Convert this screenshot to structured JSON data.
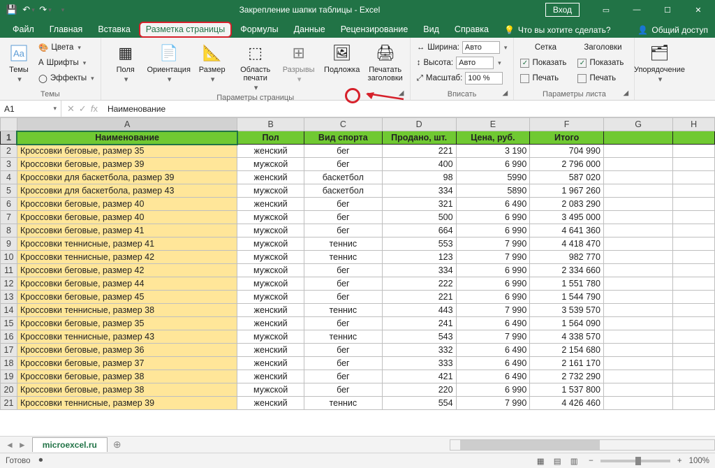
{
  "titlebar": {
    "title": "Закрепление шапки таблицы  -  Excel",
    "login": "Вход"
  },
  "tabs": {
    "file": "Файл",
    "home": "Главная",
    "insert": "Вставка",
    "pagelayout": "Разметка страницы",
    "formulas": "Формулы",
    "data": "Данные",
    "review": "Рецензирование",
    "view": "Вид",
    "help": "Справка",
    "tellme": "Что вы хотите сделать?",
    "share": "Общий доступ"
  },
  "ribbon": {
    "themes_group": "Темы",
    "themes_btn": "Темы",
    "colors": "Цвета",
    "fonts": "Шрифты",
    "effects": "Эффекты",
    "page_setup_group": "Параметры страницы",
    "margins": "Поля",
    "orientation": "Ориентация",
    "size": "Размер",
    "print_area": "Область печати",
    "breaks": "Разрывы",
    "background": "Подложка",
    "print_titles": "Печатать заголовки",
    "scale_group": "Вписать",
    "width_lbl": "Ширина:",
    "width_val": "Авто",
    "height_lbl": "Высота:",
    "height_val": "Авто",
    "scale_lbl": "Масштаб:",
    "scale_val": "100 %",
    "sheet_opts_group": "Параметры листа",
    "gridlines": "Сетка",
    "headings": "Заголовки",
    "show": "Показать",
    "print": "Печать",
    "arrange_group": "Упорядочение",
    "arrange_btn": "Упорядочение"
  },
  "namebox": "A1",
  "formula": "Наименование",
  "columns": [
    "A",
    "B",
    "C",
    "D",
    "E",
    "F",
    "G",
    "H"
  ],
  "headers": {
    "name": "Наименование",
    "gender": "Пол",
    "sport": "Вид спорта",
    "sold": "Продано, шт.",
    "price": "Цена, руб.",
    "total": "Итого"
  },
  "rows": [
    {
      "n": "Кроссовки беговые, размер 35",
      "g": "женский",
      "s": "бег",
      "sold": "221",
      "p": "3 190",
      "t": "704 990"
    },
    {
      "n": "Кроссовки беговые, размер 39",
      "g": "мужской",
      "s": "бег",
      "sold": "400",
      "p": "6 990",
      "t": "2 796 000"
    },
    {
      "n": "Кроссовки для баскетбола, размер 39",
      "g": "женский",
      "s": "баскетбол",
      "sold": "98",
      "p": "5990",
      "t": "587 020"
    },
    {
      "n": "Кроссовки для баскетбола, размер 43",
      "g": "мужской",
      "s": "баскетбол",
      "sold": "334",
      "p": "5890",
      "t": "1 967 260"
    },
    {
      "n": "Кроссовки беговые, размер 40",
      "g": "женский",
      "s": "бег",
      "sold": "321",
      "p": "6 490",
      "t": "2 083 290"
    },
    {
      "n": "Кроссовки беговые, размер 40",
      "g": "мужской",
      "s": "бег",
      "sold": "500",
      "p": "6 990",
      "t": "3 495 000"
    },
    {
      "n": "Кроссовки беговые, размер 41",
      "g": "мужской",
      "s": "бег",
      "sold": "664",
      "p": "6 990",
      "t": "4 641 360"
    },
    {
      "n": "Кроссовки теннисные, размер 41",
      "g": "мужской",
      "s": "теннис",
      "sold": "553",
      "p": "7 990",
      "t": "4 418 470"
    },
    {
      "n": "Кроссовки теннисные, размер 42",
      "g": "мужской",
      "s": "теннис",
      "sold": "123",
      "p": "7 990",
      "t": "982 770"
    },
    {
      "n": "Кроссовки беговые, размер 42",
      "g": "мужской",
      "s": "бег",
      "sold": "334",
      "p": "6 990",
      "t": "2 334 660"
    },
    {
      "n": "Кроссовки беговые, размер 44",
      "g": "мужской",
      "s": "бег",
      "sold": "222",
      "p": "6 990",
      "t": "1 551 780"
    },
    {
      "n": "Кроссовки беговые, размер 45",
      "g": "мужской",
      "s": "бег",
      "sold": "221",
      "p": "6 990",
      "t": "1 544 790"
    },
    {
      "n": "Кроссовки теннисные, размер 38",
      "g": "женский",
      "s": "теннис",
      "sold": "443",
      "p": "7 990",
      "t": "3 539 570"
    },
    {
      "n": "Кроссовки беговые, размер 35",
      "g": "женский",
      "s": "бег",
      "sold": "241",
      "p": "6 490",
      "t": "1 564 090"
    },
    {
      "n": "Кроссовки теннисные, размер 43",
      "g": "мужской",
      "s": "теннис",
      "sold": "543",
      "p": "7 990",
      "t": "4 338 570"
    },
    {
      "n": "Кроссовки беговые, размер 36",
      "g": "женский",
      "s": "бег",
      "sold": "332",
      "p": "6 490",
      "t": "2 154 680"
    },
    {
      "n": "Кроссовки беговые, размер 37",
      "g": "женский",
      "s": "бег",
      "sold": "333",
      "p": "6 490",
      "t": "2 161 170"
    },
    {
      "n": "Кроссовки беговые, размер 38",
      "g": "женский",
      "s": "бег",
      "sold": "421",
      "p": "6 490",
      "t": "2 732 290"
    },
    {
      "n": "Кроссовки беговые, размер 38",
      "g": "мужской",
      "s": "бег",
      "sold": "220",
      "p": "6 990",
      "t": "1 537 800"
    },
    {
      "n": "Кроссовки теннисные, размер 39",
      "g": "женский",
      "s": "теннис",
      "sold": "554",
      "p": "7 990",
      "t": "4 426 460"
    }
  ],
  "sheet": {
    "name": "microexcel.ru"
  },
  "status": {
    "ready": "Готово",
    "zoom": "100%"
  }
}
